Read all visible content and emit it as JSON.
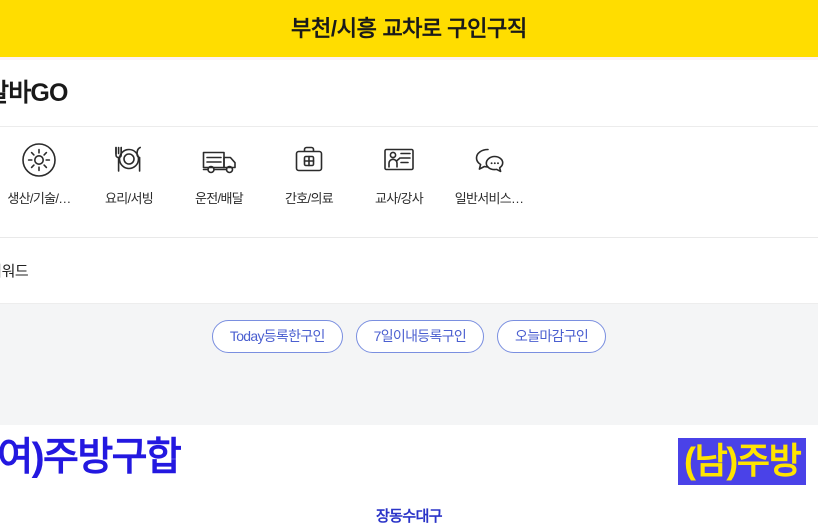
{
  "banner": {
    "title_prefix": "부천/시흥 ",
    "title_strong": "교차로",
    "title_suffix": " 구인구직",
    "background_color": "#ffdd00"
  },
  "brand": {
    "logo_text": "알바GO"
  },
  "categories": {
    "items": [
      {
        "label": "생산/기술/…",
        "icon": "gear-icon"
      },
      {
        "label": "요리/서빙",
        "icon": "cutlery-plate-icon"
      },
      {
        "label": "운전/배달",
        "icon": "delivery-truck-icon"
      },
      {
        "label": "간호/의료",
        "icon": "medical-kit-icon"
      },
      {
        "label": "교사/강사",
        "icon": "teacher-board-icon"
      },
      {
        "label": "일반서비스…",
        "icon": "chat-bubbles-icon"
      }
    ]
  },
  "keyword_band": {
    "clipped_text": "검색 키워드"
  },
  "quick_filters": {
    "pills": [
      {
        "label": "Today등록한구인"
      },
      {
        "label": "7일이내등록구인"
      },
      {
        "label": "오늘마감구인"
      }
    ],
    "border_color": "#7a8fe0",
    "text_color": "#4b5fd0",
    "background_color": "#f4f5f6"
  },
  "listings": {
    "left_title": "(여)주방구합",
    "left_title_color": "#2318e0",
    "right_title": "(남)주방",
    "right_title_color": "#ffe400",
    "right_title_background": "#4a42e8",
    "sub_text": "장동수대구"
  }
}
